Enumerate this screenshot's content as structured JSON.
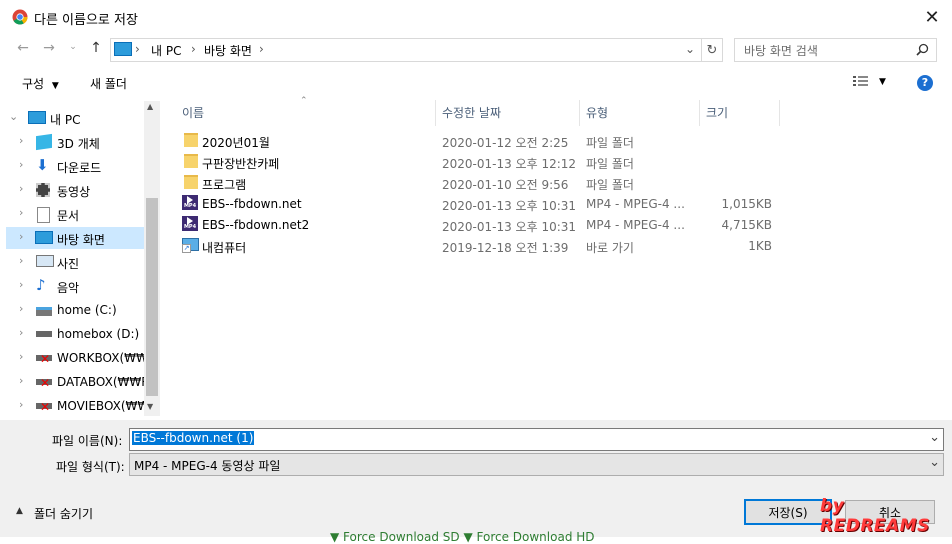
{
  "window": {
    "title": "다른 이름으로 저장",
    "close_glyph": "✕"
  },
  "address": {
    "segments": [
      "내 PC",
      "바탕 화면"
    ],
    "separator": "›"
  },
  "search": {
    "placeholder": "바탕 화면 검색"
  },
  "toolbar": {
    "organize_label": "구성",
    "new_folder_label": "새 폴더"
  },
  "tree": {
    "items": [
      {
        "label": "내 PC",
        "icon": "pc-icon"
      },
      {
        "label": "3D 개체",
        "icon": "cube-icon"
      },
      {
        "label": "다운로드",
        "icon": "download-icon"
      },
      {
        "label": "동영상",
        "icon": "video-icon"
      },
      {
        "label": "문서",
        "icon": "document-icon"
      },
      {
        "label": "바탕 화면",
        "icon": "desktop-icon"
      },
      {
        "label": "사진",
        "icon": "picture-icon"
      },
      {
        "label": "음악",
        "icon": "music-icon"
      },
      {
        "label": "home (C:)",
        "icon": "drive-icon"
      },
      {
        "label": "homebox (D:)",
        "icon": "drive-icon"
      },
      {
        "label": "WORKBOX(₩₩re",
        "icon": "network-drive-error-icon"
      },
      {
        "label": "DATABOX(₩₩R",
        "icon": "network-drive-error-icon"
      },
      {
        "label": "MOVIEBOX(₩₩R",
        "icon": "network-drive-error-icon"
      }
    ]
  },
  "columns": {
    "name": "이름",
    "modified": "수정한 날짜",
    "type": "유형",
    "size": "크기"
  },
  "files": [
    {
      "name": "2020년01월",
      "modified": "2020-01-12 오전 2:25",
      "type": "파일 폴더",
      "size": "",
      "icon": "folder-icon"
    },
    {
      "name": "구판장반찬카페",
      "modified": "2020-01-13 오후 12:12",
      "type": "파일 폴더",
      "size": "",
      "icon": "folder-icon"
    },
    {
      "name": "프로그램",
      "modified": "2020-01-10 오전 9:56",
      "type": "파일 폴더",
      "size": "",
      "icon": "folder-icon"
    },
    {
      "name": "EBS--fbdown.net",
      "modified": "2020-01-13 오후 10:31",
      "type": "MP4 - MPEG-4 ...",
      "size": "1,015KB",
      "icon": "mp4-icon"
    },
    {
      "name": "EBS--fbdown.net2",
      "modified": "2020-01-13 오후 10:31",
      "type": "MP4 - MPEG-4 ...",
      "size": "4,715KB",
      "icon": "mp4-icon"
    },
    {
      "name": "내컴퓨터",
      "modified": "2019-12-18 오전 1:39",
      "type": "바로 가기",
      "size": "1KB",
      "icon": "shortcut-icon"
    }
  ],
  "save_form": {
    "filename_label": "파일 이름(N):",
    "filename_value": "EBS--fbdown.net (1)",
    "filetype_label": "파일 형식(T):",
    "filetype_value": "MP4 - MPEG-4 동영상 파일"
  },
  "footer": {
    "hide_folders_label": "폴더 숨기기",
    "save_button": "저장(S)",
    "cancel_button": "취소"
  },
  "watermark": "by REDREAMS",
  "background_strip": "▼ Force Download SD  ▼ Force Download HD",
  "colors": {
    "accent": "#0078d7",
    "selection": "#cce8ff",
    "folder": "#f7d36b",
    "watermark": "#ff3b3b"
  }
}
